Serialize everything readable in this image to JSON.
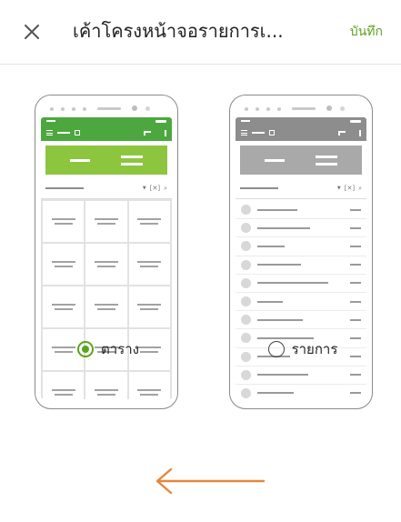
{
  "header": {
    "title": "เค้าโครงหน้าจอรายการเ...",
    "save_label": "บันทึก"
  },
  "layouts": [
    {
      "label": "ตาราง",
      "selected": true,
      "kind": "grid"
    },
    {
      "label": "รายการ",
      "selected": false,
      "kind": "list"
    }
  ],
  "colors": {
    "accent": "#5ba31e",
    "grid_toolbar": "#4ca83e",
    "grid_banner": "#8cc63f",
    "list_toolbar": "#8d8d8d",
    "list_banner": "#a9a9a9",
    "arrow": "#e5883a"
  },
  "icons": {
    "close": "close-icon",
    "arrow": "arrow-left-icon"
  }
}
